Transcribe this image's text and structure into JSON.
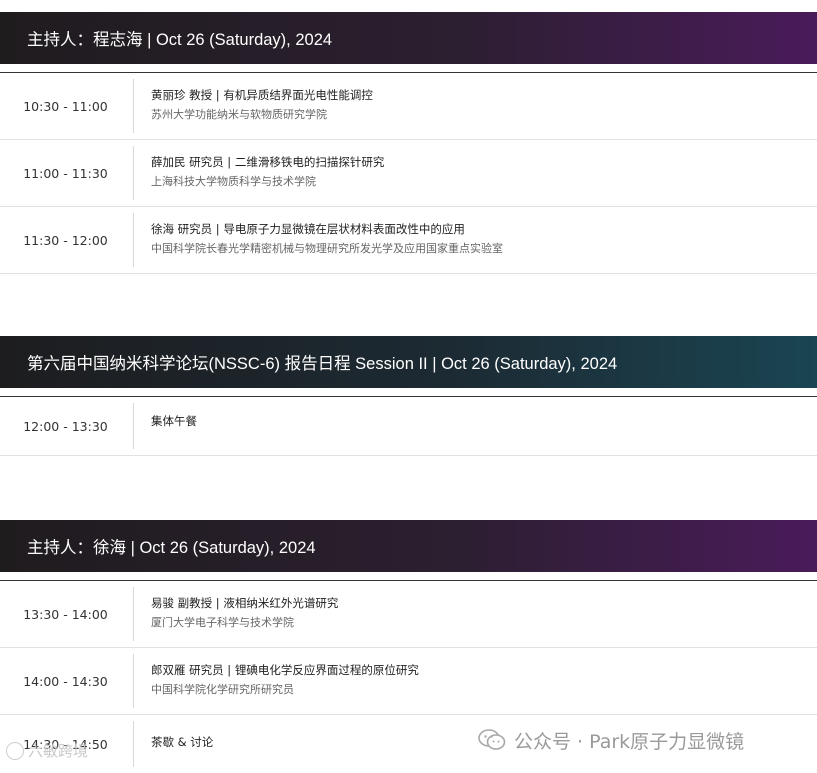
{
  "sessions": [
    {
      "header": "主持人：程志海 | Oct 26 (Saturday), 2024",
      "rows": [
        {
          "time": "10:30 - 11:00",
          "title": "黄丽珍 教授 | 有机异质结界面光电性能调控",
          "inst": "苏州大学功能纳米与软物质研究学院"
        },
        {
          "time": "11:00 - 11:30",
          "title": "薛加民 研究员 | 二维滑移铁电的扫描探针研究",
          "inst": "上海科技大学物质科学与技术学院"
        },
        {
          "time": "11:30 - 12:00",
          "title": "徐海 研究员 | 导电原子力显微镜在层状材料表面改性中的应用",
          "inst": "中国科学院长春光学精密机械与物理研究所发光学及应用国家重点实验室"
        }
      ]
    },
    {
      "header": "第六届中国纳米科学论坛(NSSC-6) 报告日程 Session II | Oct 26 (Saturday), 2024",
      "rows": [
        {
          "time": "12:00 - 13:30",
          "title": "集体午餐",
          "inst": ""
        }
      ]
    },
    {
      "header": "主持人：徐海 | Oct 26 (Saturday), 2024",
      "rows": [
        {
          "time": "13:30 - 14:00",
          "title": "易骏 副教授 | 液相纳米红外光谱研究",
          "inst": "厦门大学电子科学与技术学院"
        },
        {
          "time": "14:00 - 14:30",
          "title": "郎双雁 研究员 | 锂碘电化学反应界面过程的原位研究",
          "inst": "中国科学院化学研究所研究员"
        },
        {
          "time": "14:30 - 14:50",
          "title": "茶歇 & 讨论",
          "inst": ""
        }
      ]
    }
  ],
  "watermark": {
    "text": "公众号 · Park原子力显微镜",
    "icon": "wechat-icon"
  },
  "watermark2": {
    "text": "六敏跨境"
  },
  "colors": {
    "header_purple_end": "#4a1b5a",
    "header_teal_end": "#1a4552"
  }
}
